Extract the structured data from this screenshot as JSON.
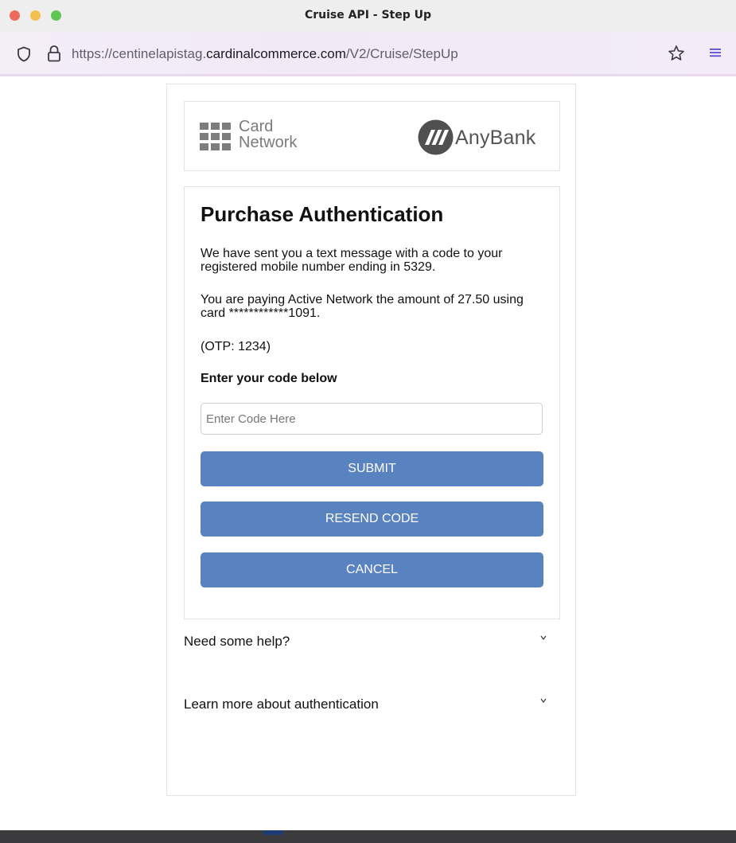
{
  "window": {
    "title": "Cruise API - Step Up"
  },
  "browser": {
    "url_prefix": "https://centinelapistag.",
    "url_domain": "cardinalcommerce.com",
    "url_path": "/V2/Cruise/StepUp",
    "icons": [
      "shield-icon",
      "lock-icon",
      "star-icon",
      "menu-icon"
    ]
  },
  "logos": {
    "card_network": "Card\nNetwork",
    "anybank": "AnyBank"
  },
  "auth": {
    "heading": "Purchase Authentication",
    "sms_message": "We have sent you a text message with a code to your registered mobile number ending in 5329.",
    "payment_message": "You are paying Active Network the amount of 27.50 using card ************1091.",
    "otp_hint": "(OTP: 1234)",
    "code_label": "Enter your code below",
    "code_placeholder": "Enter Code Here",
    "code_value": "",
    "submit_label": "SUBMIT",
    "resend_label": "RESEND CODE",
    "cancel_label": "CANCEL"
  },
  "accordions": {
    "help": "Need some help?",
    "learn": "Learn more about authentication",
    "chevron": "v"
  },
  "colors": {
    "button": "#5982c0",
    "toolbar": "#f1eaf6",
    "text": "#111111"
  }
}
